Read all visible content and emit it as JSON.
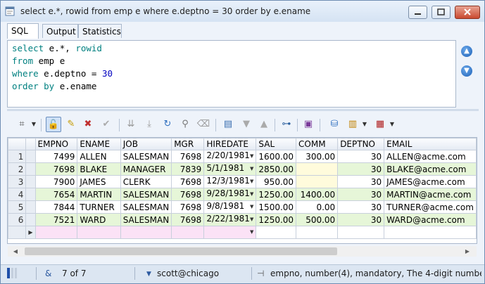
{
  "window": {
    "title": "select e.*, rowid from emp e where e.deptno = 30 order by e.ename"
  },
  "tabs": [
    {
      "label": "SQL",
      "active": true
    },
    {
      "label": "Output",
      "active": false
    },
    {
      "label": "Statistics",
      "active": false
    }
  ],
  "editor": {
    "lines": [
      {
        "kw": "select",
        "rest": " e.*, ",
        "kw2": "rowid",
        "num": ""
      },
      {
        "kw": "from",
        "rest": " emp e",
        "kw2": "",
        "num": ""
      },
      {
        "kw": "where",
        "rest": " e.deptno = ",
        "kw2": "",
        "num": "30"
      },
      {
        "kw": "order by",
        "rest": " e.ename",
        "kw2": "",
        "num": ""
      }
    ]
  },
  "grid": {
    "columns": [
      "EMPNO",
      "ENAME",
      "JOB",
      "MGR",
      "HIREDATE",
      "SAL",
      "COMM",
      "DEPTNO",
      "EMAIL"
    ],
    "rows": [
      {
        "n": "1",
        "empno": "7499",
        "ename": "ALLEN",
        "job": "SALESMAN",
        "mgr": "7698",
        "hiredate": "2/20/1981",
        "sal": "1600.00",
        "comm": "300.00",
        "deptno": "30",
        "email": "ALLEN@acme.com"
      },
      {
        "n": "2",
        "empno": "7698",
        "ename": "BLAKE",
        "job": "MANAGER",
        "mgr": "7839",
        "hiredate": "5/1/1981",
        "sal": "2850.00",
        "comm": "",
        "deptno": "30",
        "email": "BLAKE@acme.com"
      },
      {
        "n": "3",
        "empno": "7900",
        "ename": "JAMES",
        "job": "CLERK",
        "mgr": "7698",
        "hiredate": "12/3/1981",
        "sal": "950.00",
        "comm": "",
        "deptno": "30",
        "email": "JAMES@acme.com"
      },
      {
        "n": "4",
        "empno": "7654",
        "ename": "MARTIN",
        "job": "SALESMAN",
        "mgr": "7698",
        "hiredate": "9/28/1981",
        "sal": "1250.00",
        "comm": "1400.00",
        "deptno": "30",
        "email": "MARTIN@acme.com"
      },
      {
        "n": "5",
        "empno": "7844",
        "ename": "TURNER",
        "job": "SALESMAN",
        "mgr": "7698",
        "hiredate": "9/8/1981",
        "sal": "1500.00",
        "comm": "0.00",
        "deptno": "30",
        "email": "TURNER@acme.com"
      },
      {
        "n": "6",
        "empno": "7521",
        "ename": "WARD",
        "job": "SALESMAN",
        "mgr": "7698",
        "hiredate": "2/22/1981",
        "sal": "1250.00",
        "comm": "500.00",
        "deptno": "30",
        "email": "WARD@acme.com"
      }
    ]
  },
  "status": {
    "record_count": "7 of 7",
    "connection": "scott@chicago",
    "column_hint": "empno, number(4), mandatory, The 4-digit number c"
  },
  "colors": {
    "accent": "#1f62b8",
    "row_alt": "#e6f6d8",
    "new_row": "#fbe2f6",
    "null_cell": "#fffbdc"
  }
}
